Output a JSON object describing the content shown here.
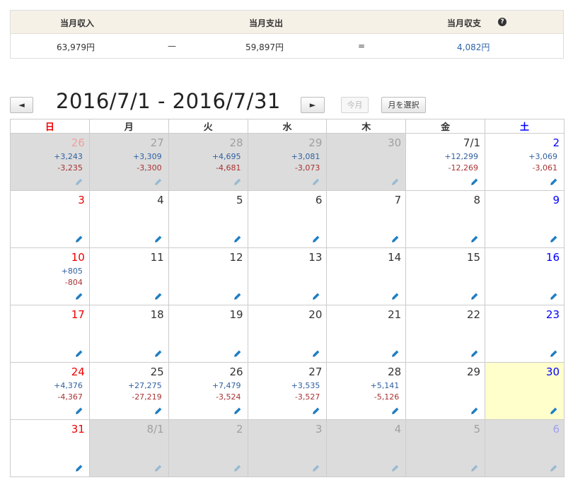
{
  "summary": {
    "income_label": "当月収入",
    "expense_label": "当月支出",
    "balance_label": "当月収支",
    "help_icon": "?",
    "income_value": "63,979円",
    "minus_sign": "—",
    "expense_value": "59,897円",
    "equals_sign": "=",
    "balance_value": "4,082円",
    "balance_color": "#2f64a8"
  },
  "nav": {
    "prev_label": "◄",
    "range_title": "2016/7/1 - 2016/7/31",
    "next_label": "►",
    "today_label": "今月",
    "select_month_label": "月を選択"
  },
  "calendar": {
    "weekdays": [
      "日",
      "月",
      "火",
      "水",
      "木",
      "金",
      "土"
    ],
    "colors": {
      "sunday": "#ee0000",
      "saturday": "#0000ff",
      "income": "#2f5fa0",
      "expense": "#a83232",
      "other_month_bg": "#dcdcdc",
      "today_bg": "#ffffcc"
    },
    "weeks": [
      [
        {
          "day": "26",
          "other": true,
          "income": "+3,243",
          "expense": "-3,235"
        },
        {
          "day": "27",
          "other": true,
          "income": "+3,309",
          "expense": "-3,300"
        },
        {
          "day": "28",
          "other": true,
          "income": "+4,695",
          "expense": "-4,681"
        },
        {
          "day": "29",
          "other": true,
          "income": "+3,081",
          "expense": "-3,073"
        },
        {
          "day": "30",
          "other": true,
          "income": "",
          "expense": ""
        },
        {
          "day": "7/1",
          "other": false,
          "income": "+12,299",
          "expense": "-12,269"
        },
        {
          "day": "2",
          "other": false,
          "income": "+3,069",
          "expense": "-3,061"
        }
      ],
      [
        {
          "day": "3",
          "other": false,
          "income": "",
          "expense": ""
        },
        {
          "day": "4",
          "other": false,
          "income": "",
          "expense": ""
        },
        {
          "day": "5",
          "other": false,
          "income": "",
          "expense": ""
        },
        {
          "day": "6",
          "other": false,
          "income": "",
          "expense": ""
        },
        {
          "day": "7",
          "other": false,
          "income": "",
          "expense": ""
        },
        {
          "day": "8",
          "other": false,
          "income": "",
          "expense": ""
        },
        {
          "day": "9",
          "other": false,
          "income": "",
          "expense": ""
        }
      ],
      [
        {
          "day": "10",
          "other": false,
          "income": "+805",
          "expense": "-804"
        },
        {
          "day": "11",
          "other": false,
          "income": "",
          "expense": ""
        },
        {
          "day": "12",
          "other": false,
          "income": "",
          "expense": ""
        },
        {
          "day": "13",
          "other": false,
          "income": "",
          "expense": ""
        },
        {
          "day": "14",
          "other": false,
          "income": "",
          "expense": ""
        },
        {
          "day": "15",
          "other": false,
          "income": "",
          "expense": ""
        },
        {
          "day": "16",
          "other": false,
          "income": "",
          "expense": ""
        }
      ],
      [
        {
          "day": "17",
          "other": false,
          "income": "",
          "expense": ""
        },
        {
          "day": "18",
          "other": false,
          "income": "",
          "expense": ""
        },
        {
          "day": "19",
          "other": false,
          "income": "",
          "expense": ""
        },
        {
          "day": "20",
          "other": false,
          "income": "",
          "expense": ""
        },
        {
          "day": "21",
          "other": false,
          "income": "",
          "expense": ""
        },
        {
          "day": "22",
          "other": false,
          "income": "",
          "expense": ""
        },
        {
          "day": "23",
          "other": false,
          "income": "",
          "expense": ""
        }
      ],
      [
        {
          "day": "24",
          "other": false,
          "income": "+4,376",
          "expense": "-4,367"
        },
        {
          "day": "25",
          "other": false,
          "income": "+27,275",
          "expense": "-27,219"
        },
        {
          "day": "26",
          "other": false,
          "income": "+7,479",
          "expense": "-3,524"
        },
        {
          "day": "27",
          "other": false,
          "income": "+3,535",
          "expense": "-3,527"
        },
        {
          "day": "28",
          "other": false,
          "income": "+5,141",
          "expense": "-5,126"
        },
        {
          "day": "29",
          "other": false,
          "income": "",
          "expense": ""
        },
        {
          "day": "30",
          "other": false,
          "today": true,
          "income": "",
          "expense": ""
        }
      ],
      [
        {
          "day": "31",
          "other": false,
          "income": "",
          "expense": ""
        },
        {
          "day": "8/1",
          "other": true,
          "income": "",
          "expense": ""
        },
        {
          "day": "2",
          "other": true,
          "income": "",
          "expense": ""
        },
        {
          "day": "3",
          "other": true,
          "income": "",
          "expense": ""
        },
        {
          "day": "4",
          "other": true,
          "income": "",
          "expense": ""
        },
        {
          "day": "5",
          "other": true,
          "income": "",
          "expense": ""
        },
        {
          "day": "6",
          "other": true,
          "income": "",
          "expense": ""
        }
      ]
    ]
  }
}
